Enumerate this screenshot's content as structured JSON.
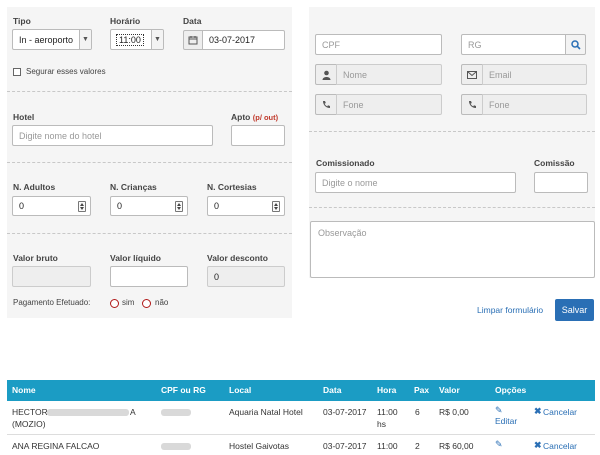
{
  "labels": {
    "tipo": "Tipo",
    "horario": "Horário",
    "data": "Data",
    "segurar": "Segurar esses valores",
    "hotel": "Hotel",
    "apto": "Apto",
    "apto_hint": "(p/ out)",
    "adultos": "N. Adultos",
    "criancas": "N. Crianças",
    "cortesias": "N. Cortesias",
    "valor_bruto": "Valor bruto",
    "valor_liquido": "Valor líquido",
    "valor_desconto": "Valor desconto",
    "pagamento": "Pagamento Efetuado:",
    "sim": "sim",
    "nao": "não",
    "comissionado": "Comissionado",
    "comissao": "Comissão"
  },
  "fields": {
    "tipo": "In - aeroporto",
    "horario": "11:00",
    "data": "03-07-2017",
    "hotel_placeholder": "Digite nome do hotel",
    "adultos": "0",
    "criancas": "0",
    "cortesias": "0",
    "desconto": "0",
    "cpf_placeholder": "CPF",
    "rg_placeholder": "RG",
    "nome_placeholder": "Nome",
    "email_placeholder": "Email",
    "fone1_placeholder": "Fone",
    "fone2_placeholder": "Fone",
    "comissionado_placeholder": "Digite o nome",
    "observacao_placeholder": "Observação"
  },
  "actions": {
    "limpar": "Limpar formulário",
    "salvar": "Salvar"
  },
  "icons": [
    "calendar-icon",
    "search-icon",
    "user-icon",
    "envelope-icon",
    "phone-icon",
    "pencil-icon",
    "times-icon",
    "chevron-down-icon",
    "spinner-icon"
  ],
  "colors": {
    "accent": "#1b9cc4",
    "button": "#2a6fb5",
    "radio": "#b01818"
  },
  "table": {
    "headers": [
      "Nome",
      "CPF ou RG",
      "Local",
      "Data",
      "Hora",
      "Pax",
      "Valor",
      "Opções"
    ],
    "rows": [
      {
        "nome1": "HECTOR",
        "nome1b": "A",
        "nome2": "(MOZIO)",
        "local": "Aquaria Natal Hotel",
        "data": "03-07-2017",
        "hora1": "11:00",
        "hora2": "hs",
        "pax": "6",
        "valor": "R$ 0,00",
        "editar": "Editar",
        "cancelar": "Cancelar"
      },
      {
        "nome1": "ANA REGINA FALCAO",
        "local": "Hostel Gaivotas",
        "data": "03-07-2017",
        "hora1": "11:00",
        "pax": "2",
        "valor": "R$ 60,00",
        "cancelar": "Cancelar"
      }
    ]
  }
}
